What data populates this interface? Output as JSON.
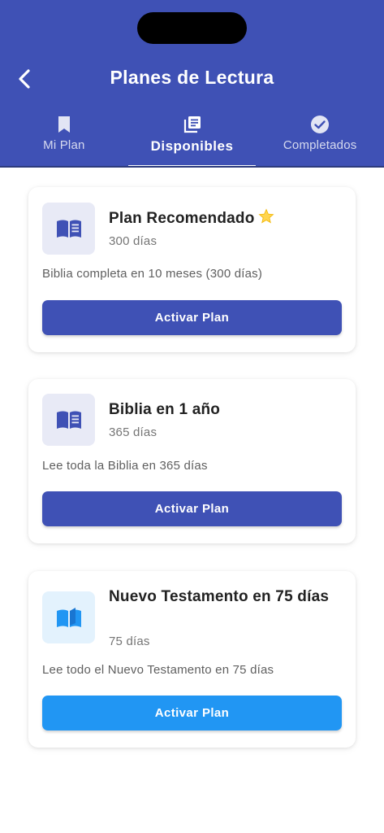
{
  "header": {
    "title": "Planes de Lectura",
    "back_icon": "chevron-left-icon",
    "color": "#3f51b5"
  },
  "tabs": [
    {
      "label": "Mi Plan",
      "icon": "bookmark-icon",
      "active": false
    },
    {
      "label": "Disponibles",
      "icon": "library-books-icon",
      "active": true
    },
    {
      "label": "Completados",
      "icon": "check-circle-icon",
      "active": false
    }
  ],
  "plans": [
    {
      "title": "Plan Recomendado",
      "badge_icon": "star-icon",
      "days": "300 días",
      "description": "Biblia completa en 10 meses (300 días)",
      "button_label": "Activar Plan",
      "icon": "book-icon",
      "accent": "#3f51b5"
    },
    {
      "title": "Biblia en 1 año",
      "days": "365 días",
      "description": "Lee toda la Biblia en 365 días",
      "button_label": "Activar Plan",
      "icon": "book-icon",
      "accent": "#3f51b5"
    },
    {
      "title": "Nuevo Testamento en 75 días",
      "days": "75 días",
      "description": "Lee todo el Nuevo Testamento en 75 días",
      "button_label": "Activar Plan",
      "icon": "open-book-icon",
      "accent": "#2196f3"
    }
  ]
}
